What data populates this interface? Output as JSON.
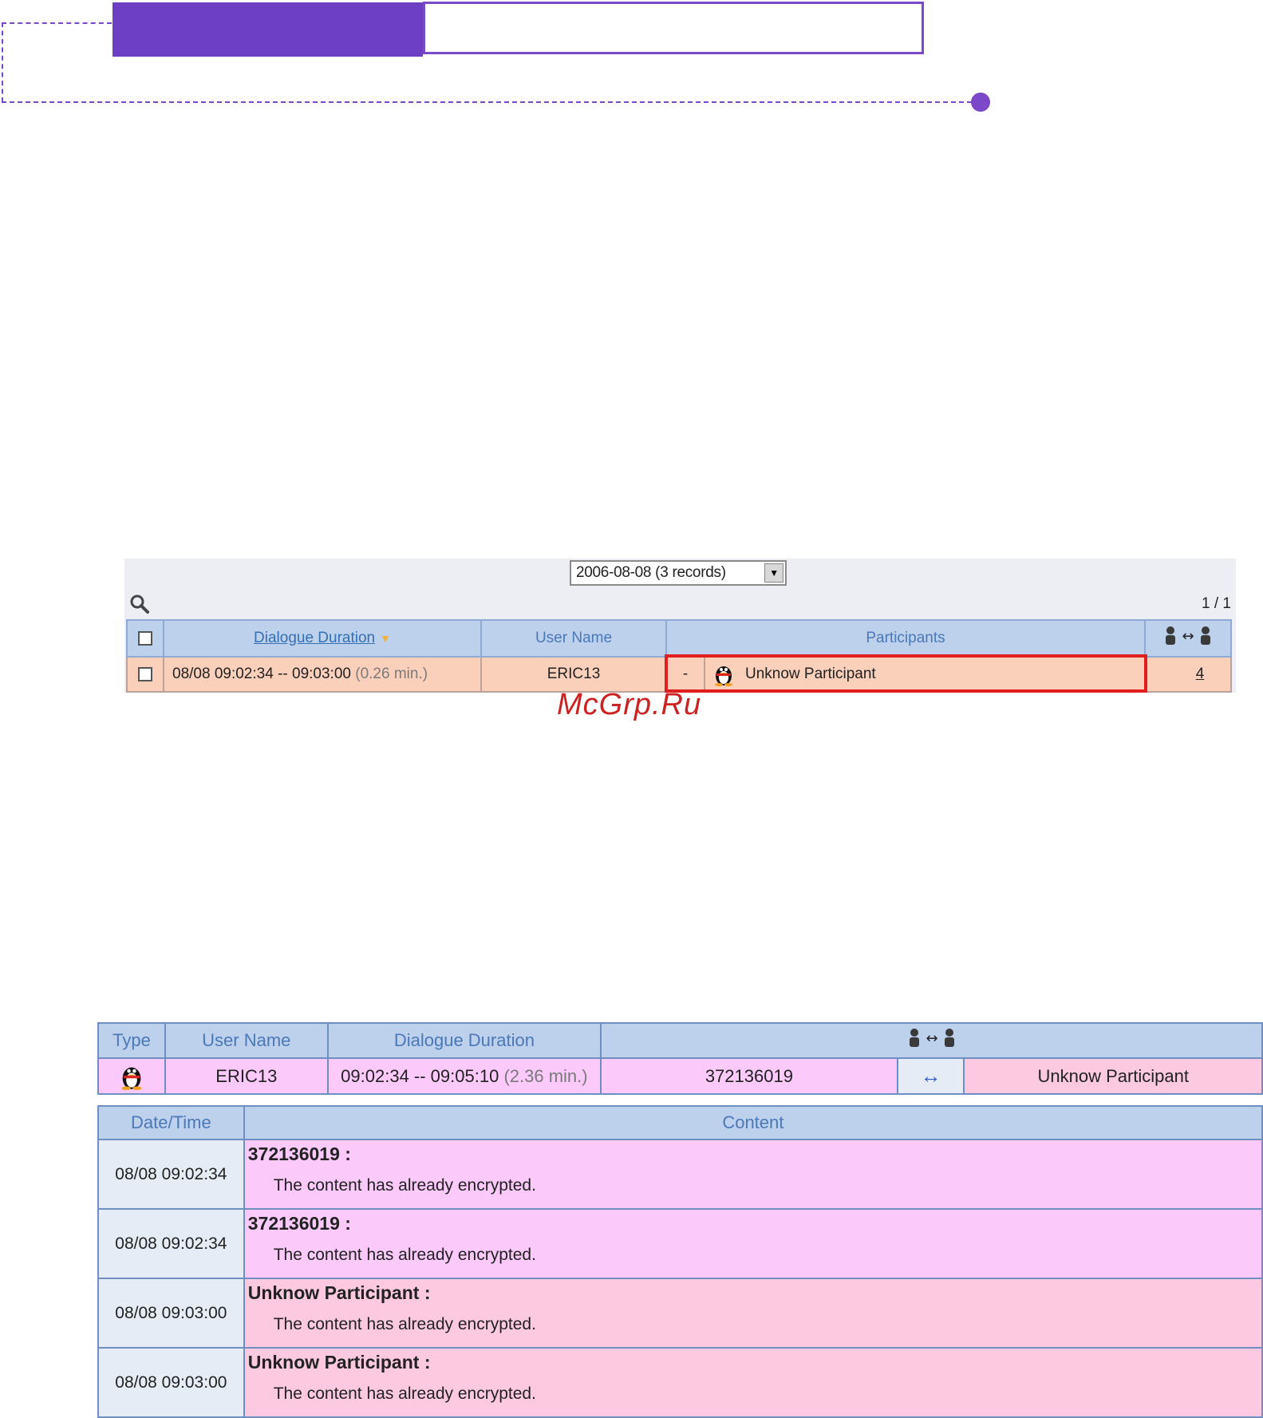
{
  "screenshot1": {
    "date_select": "2006-08-08 (3 records)",
    "pager": "1 / 1",
    "columns": {
      "duration": "Dialogue Duration",
      "user": "User Name",
      "participants": "Participants",
      "count": "↔"
    },
    "row": {
      "duration": "08/08 09:02:34 -- 09:03:00",
      "duration_min": "(0.26 min.)",
      "user": "ERIC13",
      "direction": "-",
      "participant": "Unknow Participant",
      "count": "4"
    }
  },
  "watermark": "McGrp.Ru",
  "screenshot2": {
    "columns": {
      "type": "Type",
      "user": "User Name",
      "duration": "Dialogue Duration",
      "participants": "↔"
    },
    "row": {
      "user": "ERIC13",
      "duration": "09:02:34 -- 09:05:10",
      "duration_min": "(2.36 min.)",
      "local_id": "372136019",
      "direction": "↔",
      "remote": "Unknow Participant"
    },
    "content_columns": {
      "datetime": "Date/Time",
      "content": "Content"
    },
    "messages": [
      {
        "datetime": "08/08 09:02:34",
        "sender": "372136019 :",
        "text": "The content has already encrypted."
      },
      {
        "datetime": "08/08 09:02:34",
        "sender": "372136019 :",
        "text": "The content has already encrypted."
      },
      {
        "datetime": "08/08 09:03:00",
        "sender": "Unknow Participant :",
        "text": "The content has already encrypted."
      },
      {
        "datetime": "08/08 09:03:00",
        "sender": "Unknow Participant :",
        "text": "The content has already encrypted."
      }
    ]
  },
  "colors": {
    "accent_purple": "#6d3fc4",
    "header_blue": "#bdd0ec",
    "row_peach": "#fbd0bb",
    "row_pink": "#fcc9fb",
    "row_rose": "#fcc9e0",
    "highlight_red": "#e11e1e"
  },
  "icons": [
    "search-icon",
    "penguin-icon",
    "exchange-icon",
    "sort-down-icon",
    "dropdown-arrow-icon",
    "checkbox-icon"
  ]
}
